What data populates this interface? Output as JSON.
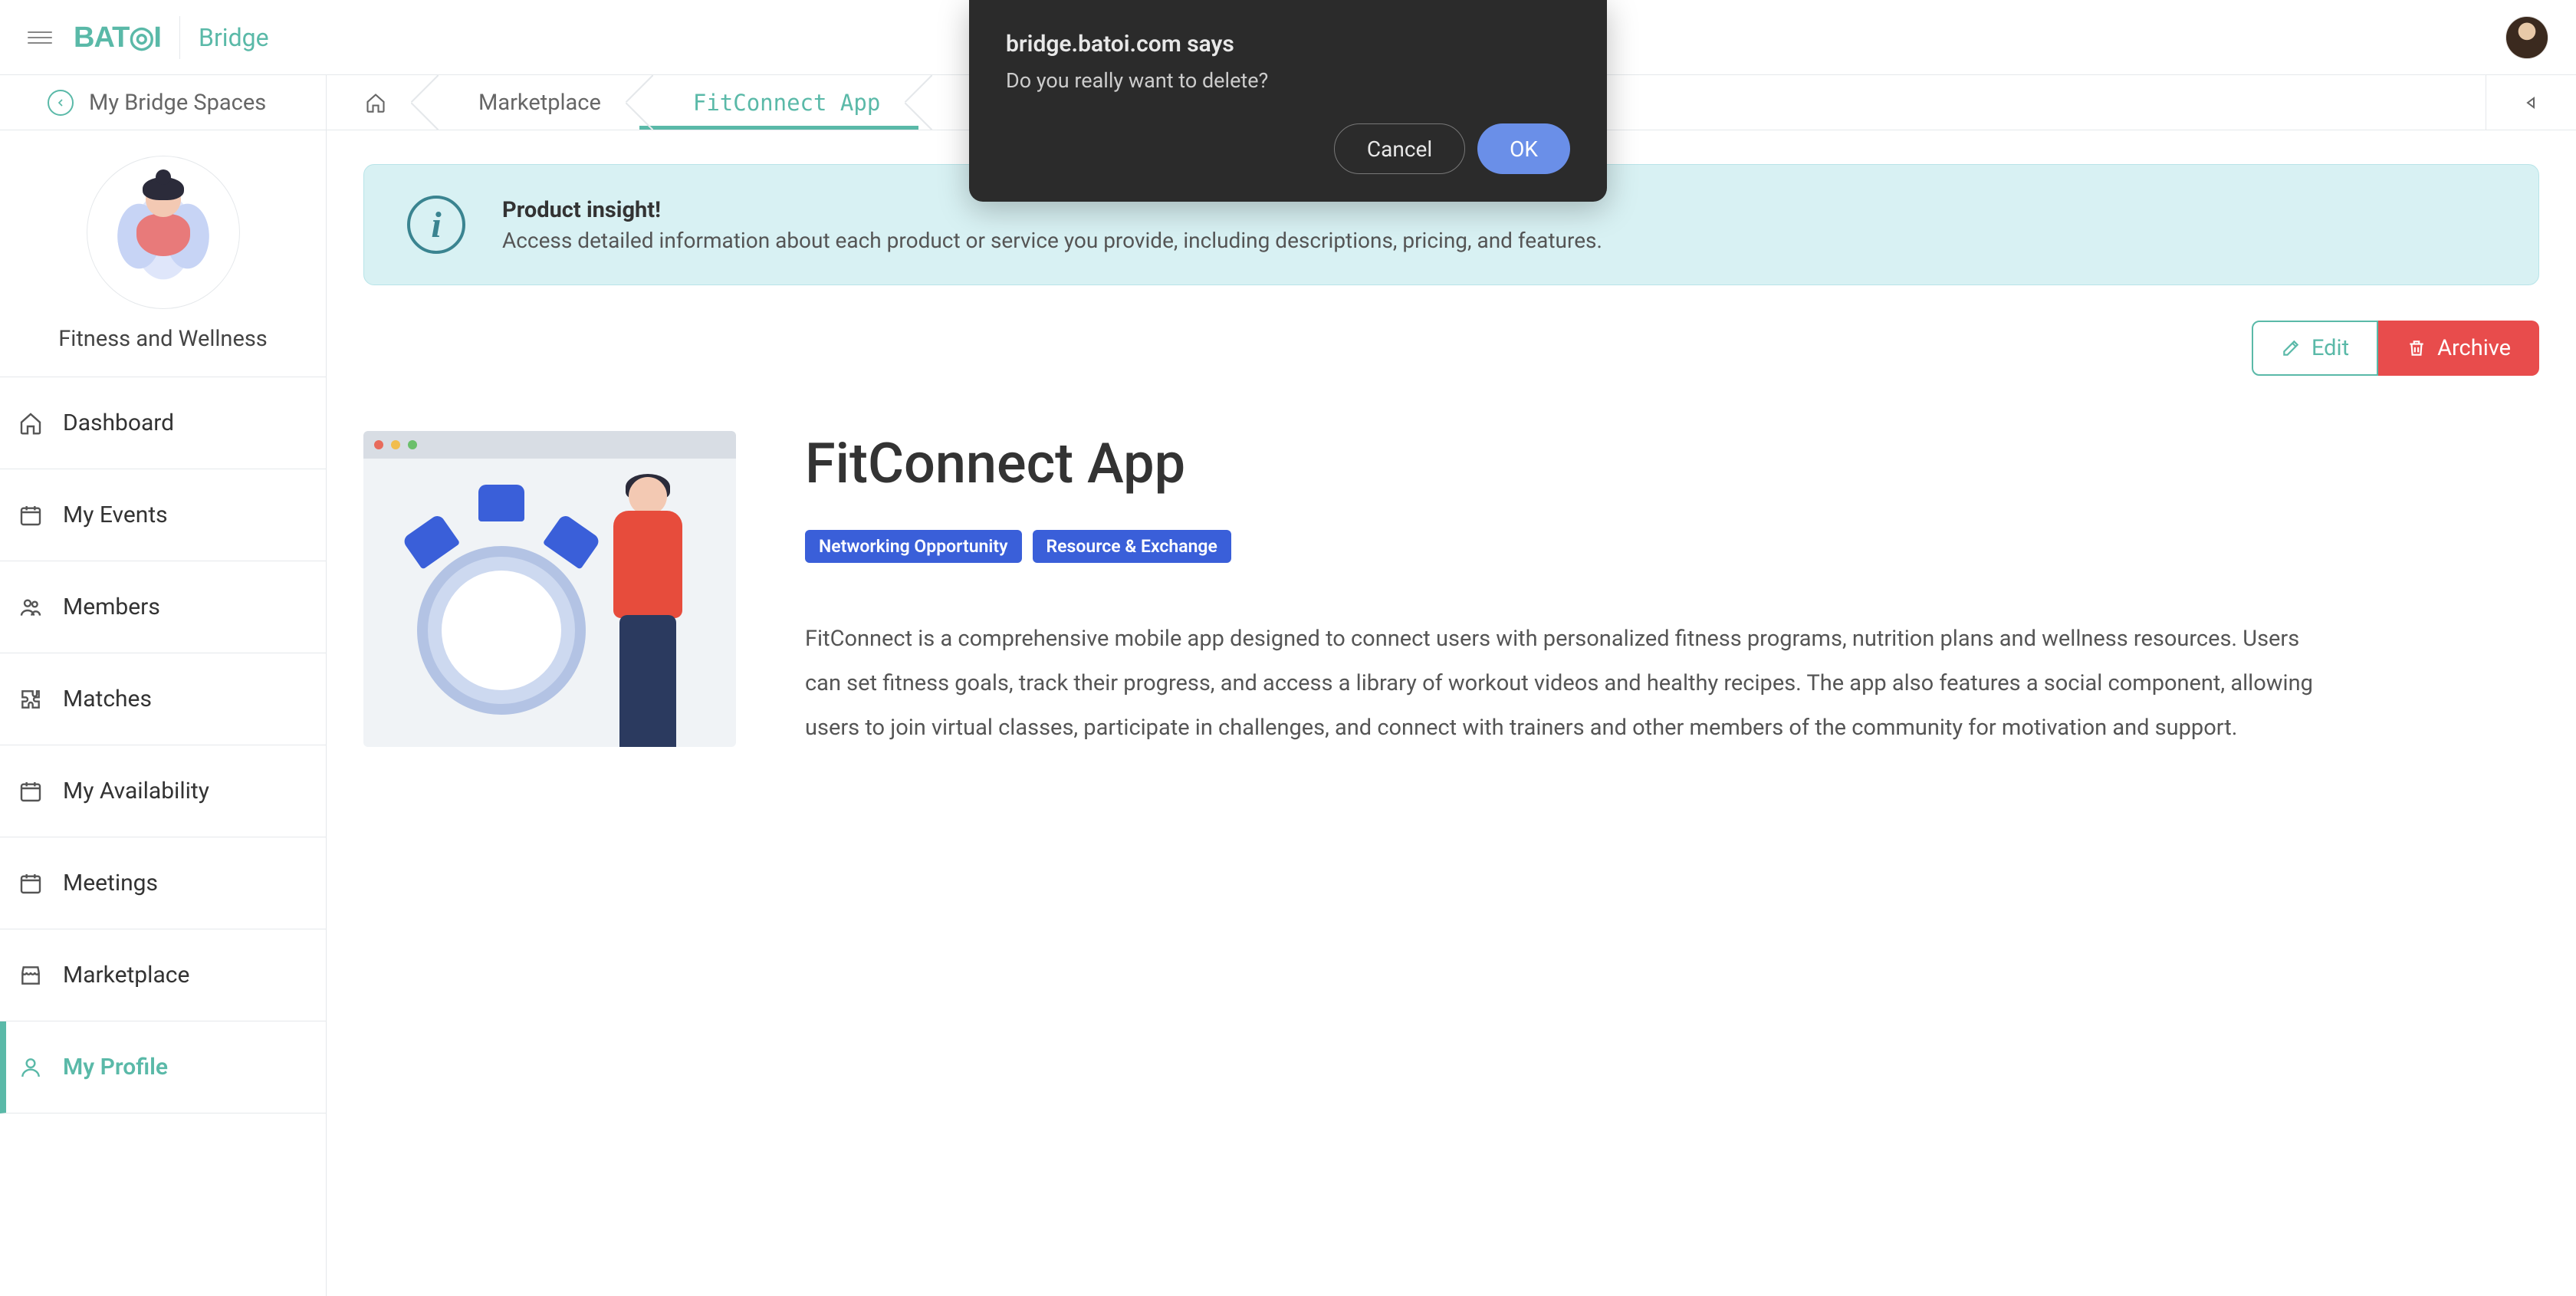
{
  "header": {
    "brand_sub": "Bridge"
  },
  "subheader": {
    "back_label": "My Bridge Spaces"
  },
  "breadcrumb": {
    "marketplace": "Marketplace",
    "active": "FitConnect App"
  },
  "sidebar": {
    "space_name": "Fitness and Wellness",
    "items": {
      "dashboard": "Dashboard",
      "my_events": "My Events",
      "members": "Members",
      "matches": "Matches",
      "my_availability": "My Availability",
      "meetings": "Meetings",
      "marketplace": "Marketplace",
      "my_profile": "My Profile"
    }
  },
  "alert": {
    "title": "Product insight!",
    "body": "Access detailed information about each product or service you provide, including descriptions, pricing, and features."
  },
  "actions": {
    "edit": "Edit",
    "archive": "Archive"
  },
  "product": {
    "title": "FitConnect App",
    "badges": {
      "networking": "Networking Opportunity",
      "resource": "Resource & Exchange"
    },
    "description": "FitConnect is a comprehensive mobile app designed to connect users with personalized fitness programs, nutrition plans and wellness resources. Users can set fitness goals, track their progress, and access a library of workout videos and healthy recipes. The app also features a social component, allowing users to join virtual classes, participate in challenges, and connect with trainers and other members of the community for motivation and support."
  },
  "dialog": {
    "origin": "bridge.batoi.com says",
    "message": "Do you really want to delete?",
    "cancel": "Cancel",
    "ok": "OK"
  }
}
